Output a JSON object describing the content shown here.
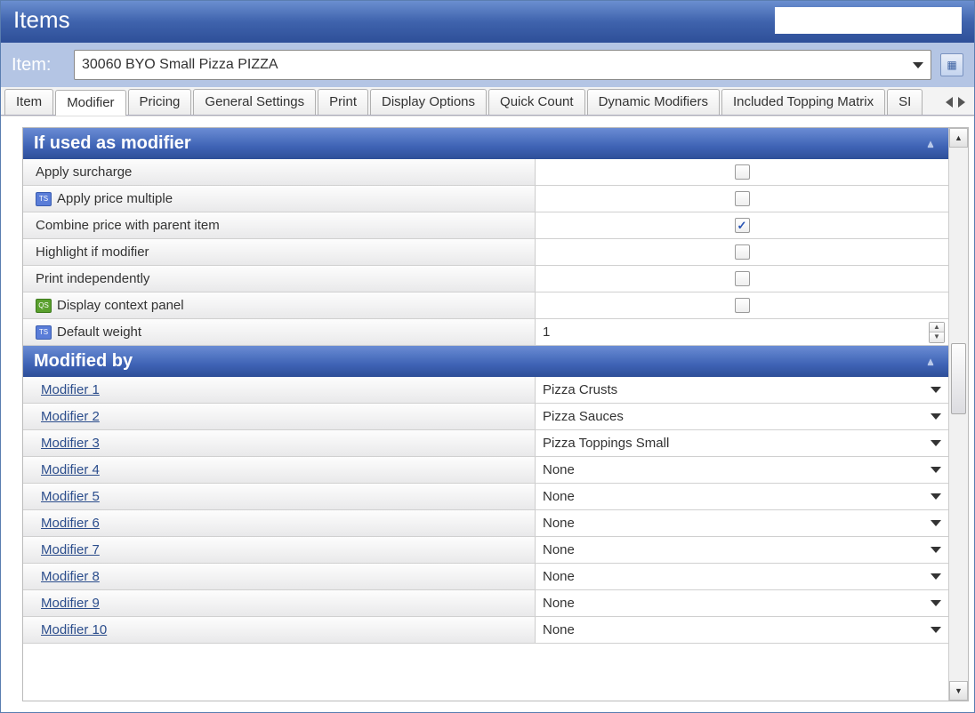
{
  "title": "Items",
  "itembar": {
    "label": "Item:",
    "selected": "30060 BYO Small Pizza PIZZA"
  },
  "tabs": [
    {
      "label": "Item",
      "active": false
    },
    {
      "label": "Modifier",
      "active": true
    },
    {
      "label": "Pricing",
      "active": false
    },
    {
      "label": "General Settings",
      "active": false
    },
    {
      "label": "Print",
      "active": false
    },
    {
      "label": "Display Options",
      "active": false
    },
    {
      "label": "Quick Count",
      "active": false
    },
    {
      "label": "Dynamic Modifiers",
      "active": false
    },
    {
      "label": "Included Topping Matrix",
      "active": false
    },
    {
      "label": "SI",
      "active": false
    }
  ],
  "section1": {
    "title": "If used as modifier",
    "rows": [
      {
        "label": "Apply surcharge",
        "icon": null,
        "type": "checkbox",
        "checked": false
      },
      {
        "label": "Apply price multiple",
        "icon": "ts",
        "type": "checkbox",
        "checked": false
      },
      {
        "label": "Combine price with parent item",
        "icon": null,
        "type": "checkbox",
        "checked": true
      },
      {
        "label": "Highlight if modifier",
        "icon": null,
        "type": "checkbox",
        "checked": false
      },
      {
        "label": "Print independently",
        "icon": null,
        "type": "checkbox",
        "checked": false
      },
      {
        "label": "Display context panel",
        "icon": "qs",
        "type": "checkbox",
        "checked": false
      },
      {
        "label": "Default weight",
        "icon": "ts",
        "type": "spinner",
        "value": "1"
      }
    ]
  },
  "section2": {
    "title": "Modified by",
    "rows": [
      {
        "label": "Modifier 1",
        "value": "Pizza Crusts"
      },
      {
        "label": "Modifier 2",
        "value": "Pizza Sauces"
      },
      {
        "label": "Modifier 3",
        "value": "Pizza Toppings Small"
      },
      {
        "label": "Modifier 4",
        "value": "None"
      },
      {
        "label": "Modifier 5",
        "value": "None"
      },
      {
        "label": "Modifier 6",
        "value": "None"
      },
      {
        "label": "Modifier 7",
        "value": "None"
      },
      {
        "label": "Modifier 8",
        "value": "None"
      },
      {
        "label": "Modifier 9",
        "value": "None"
      },
      {
        "label": "Modifier 10",
        "value": "None"
      }
    ]
  }
}
